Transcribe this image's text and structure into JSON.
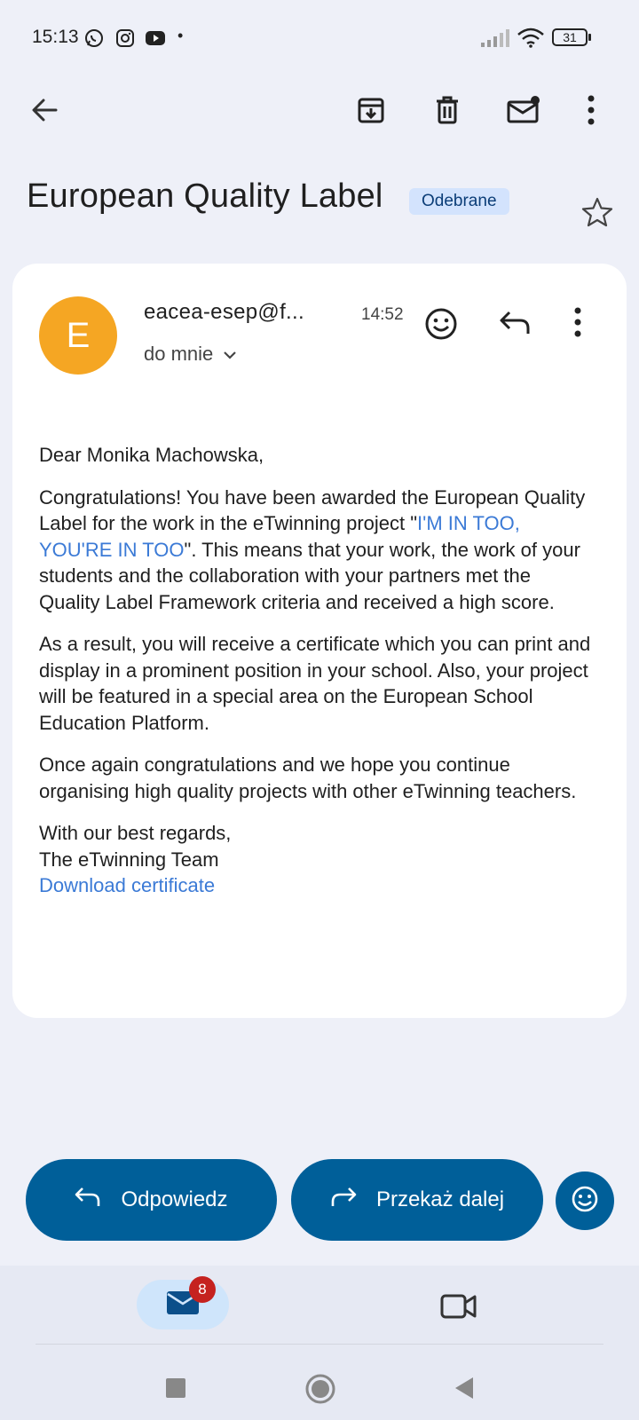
{
  "status_bar": {
    "time": "15:13",
    "app_icons": [
      "whatsapp-icon",
      "instagram-icon",
      "youtube-icon"
    ],
    "dot": "•",
    "battery": "31"
  },
  "toolbar": {
    "icons": [
      "back-arrow-icon",
      "archive-icon",
      "delete-icon",
      "mark-unread-icon",
      "more-vert-icon"
    ]
  },
  "email": {
    "subject": "European Quality Label",
    "label": "Odebrane",
    "sender": "eacea-esep@f...",
    "time": "14:52",
    "avatar_letter": "E",
    "recipient": "do mnie",
    "body": {
      "greeting": "Dear Monika Machowska,",
      "p1_before": "Congratulations! You have been awarded the European Quality Label for the work in the eTwinning project \"",
      "p1_link": "I'M IN TOO, YOU'RE IN TOO",
      "p1_after": "\". This means that your work, the work of your students and the collaboration with your partners met the Quality Label Framework criteria and received a high score.",
      "p2": "As a result, you will receive a certificate which you can print and display in a prominent position in your school. Also, your project will be featured in a special area on the European School Education Platform.",
      "p3": "Once again congratulations and we hope you continue organising high quality projects with other eTwinning teachers.",
      "closing": "With our best regards,",
      "signature": "The eTwinning Team",
      "download_link": "Download certificate"
    }
  },
  "actions": {
    "reply": "Odpowiedz",
    "forward": "Przekaż dalej"
  },
  "bottom_nav": {
    "mail_badge": "8"
  },
  "colors": {
    "accent": "#005f99",
    "avatar": "#f5a623",
    "link": "#3b7ad6",
    "badge": "#c5221f",
    "chip": "#d3e3fd"
  }
}
